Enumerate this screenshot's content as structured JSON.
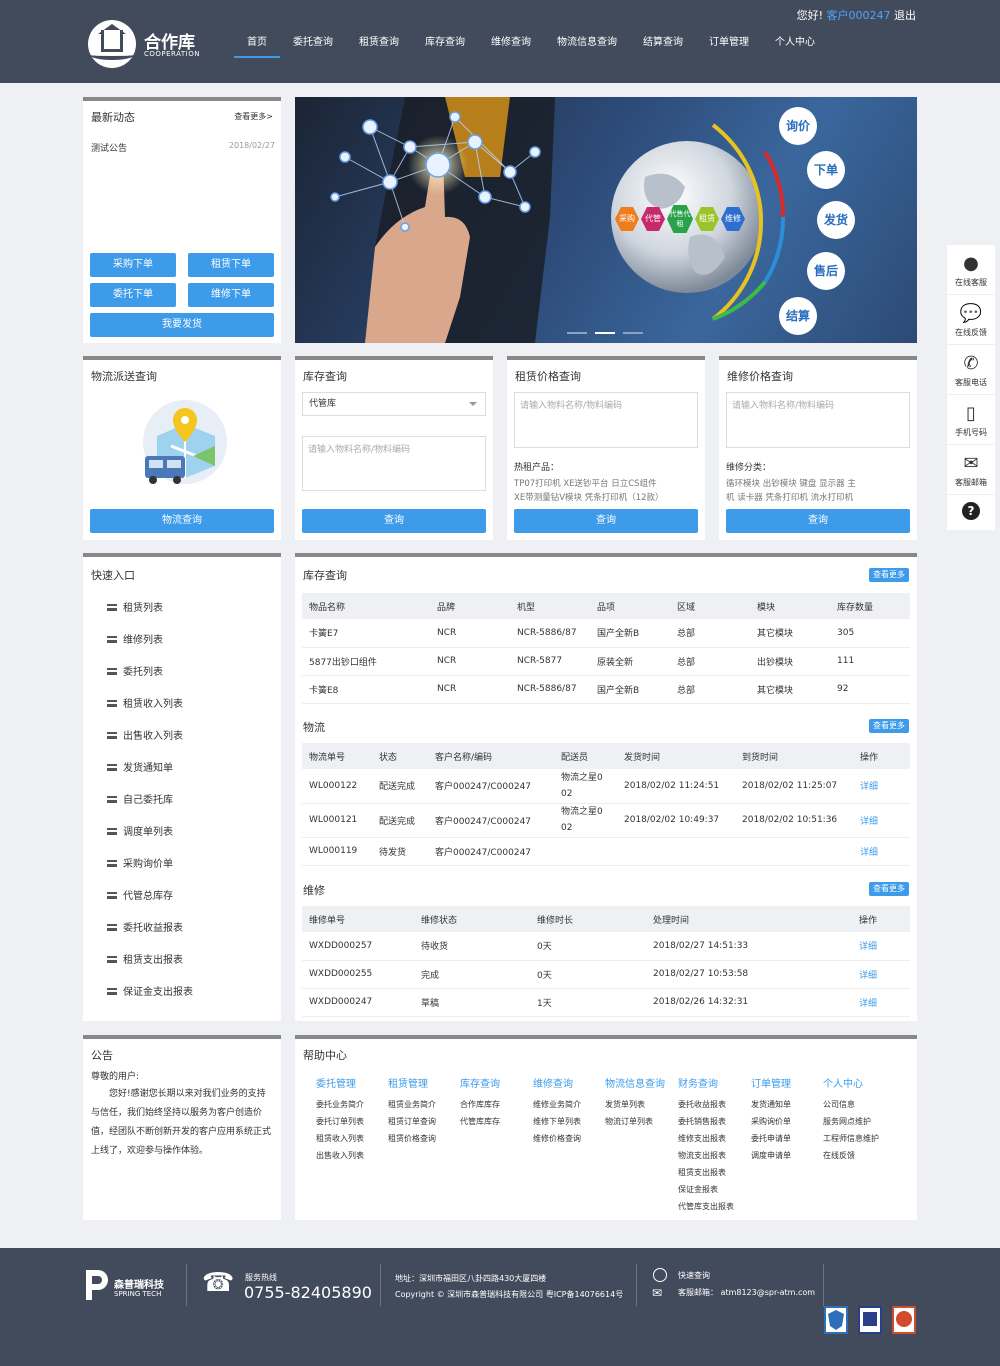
{
  "header": {
    "logo_title": "合作库",
    "logo_subtitle": "COOPERATION",
    "greeting": "您好!",
    "account": "客户000247",
    "logout": "退出",
    "nav": [
      "首页",
      "委托查询",
      "租赁查询",
      "库存查询",
      "维修查询",
      "物流信息查询",
      "结算查询",
      "订单管理",
      "个人中心"
    ]
  },
  "news": {
    "title": "最新动态",
    "more": "查看更多>",
    "items": [
      {
        "title": "测试公告",
        "date": "2018/02/27"
      }
    ],
    "buttons": [
      "采购下单",
      "租赁下单",
      "委托下单",
      "维修下单"
    ],
    "ship_button": "我要发货"
  },
  "banner": {
    "bubbles": [
      "询价",
      "下单",
      "发货",
      "售后",
      "结算"
    ],
    "hexes": [
      "采购",
      "代管",
      "代售代租",
      "租赁",
      "维修"
    ]
  },
  "logistics_query": {
    "title": "物流派送查询",
    "button": "物流查询"
  },
  "stock_query": {
    "title": "库存查询",
    "select_value": "代管库",
    "placeholder": "请输入物料名称/物料编码",
    "button": "查询"
  },
  "rent_price": {
    "title": "租赁价格查询",
    "placeholder": "请输入物料名称/物料编码",
    "hot_label": "热租产品：",
    "hot_line1": "TP07打印机   XE送钞平台   日立CS组件",
    "hot_line2": "XE带测量钻V模块   凭条打印机（12款）",
    "button": "查询"
  },
  "repair_price": {
    "title": "维修价格查询",
    "placeholder": "请输入物料名称/物料编码",
    "cat_label": "维修分类：",
    "cat_line1": "循环模块   出钞模块   键盘   显示器   主",
    "cat_line2": "机   读卡器   凭条打印机   流水打印机",
    "button": "查询"
  },
  "quick": {
    "title": "快速入口",
    "items": [
      "租赁列表",
      "维修列表",
      "委托列表",
      "租赁收入列表",
      "出售收入列表",
      "发货通知单",
      "自己委托库",
      "调度单列表",
      "采购询价单",
      "代管总库存",
      "委托收益报表",
      "租赁支出报表",
      "保证金支出报表"
    ]
  },
  "stock_table": {
    "title": "库存查询",
    "more": "查看更多",
    "headers": [
      "物品名称",
      "品牌",
      "机型",
      "品项",
      "区域",
      "模块",
      "库存数量"
    ],
    "rows": [
      [
        "卡簧E7",
        "NCR",
        "NCR-5886/87",
        "国产全新B",
        "总部",
        "其它模块",
        "305"
      ],
      [
        "5877出钞口组件",
        "NCR",
        "NCR-5877",
        "原装全新",
        "总部",
        "出钞模块",
        "111"
      ],
      [
        "卡簧E8",
        "NCR",
        "NCR-5886/87",
        "国产全新B",
        "总部",
        "其它模块",
        "92"
      ]
    ]
  },
  "logistics_table": {
    "title": "物流",
    "more": "查看更多",
    "headers": [
      "物流单号",
      "状态",
      "客户名称/编码",
      "配送员",
      "发货时间",
      "到货时间",
      "操作"
    ],
    "rows": [
      [
        "WL000122",
        "配送完成",
        "客户000247/C000247",
        "物流之星0 02",
        "2018/02/02 11:24:51",
        "2018/02/02 11:25:07",
        "详细"
      ],
      [
        "WL000121",
        "配送完成",
        "客户000247/C000247",
        "物流之星0 02",
        "2018/02/02 10:49:37",
        "2018/02/02 10:51:36",
        "详细"
      ],
      [
        "WL000119",
        "待发货",
        "客户000247/C000247",
        "",
        "",
        "",
        "详细"
      ]
    ]
  },
  "repair_table": {
    "title": "维修",
    "more": "查看更多",
    "headers": [
      "维修单号",
      "维修状态",
      "维修时长",
      "处理时间",
      "操作"
    ],
    "rows": [
      [
        "WXDD000257",
        "待收货",
        "0天",
        "2018/02/27 14:51:33",
        "详细"
      ],
      [
        "WXDD000255",
        "完成",
        "0天",
        "2018/02/27 10:53:58",
        "详细"
      ],
      [
        "WXDD000247",
        "草稿",
        "1天",
        "2018/02/26 14:32:31",
        "详细"
      ]
    ]
  },
  "notice": {
    "title": "公告",
    "salutation": "尊敬的用户:",
    "body": "您好!感谢您长期以来对我们业务的支持与信任，我们始终坚持以服务为客户创造价值，经团队不断创新开发的客户应用系统正式上线了，欢迎参与操作体验。"
  },
  "help": {
    "title": "帮助中心",
    "columns": [
      {
        "head": "委托管理",
        "links": [
          "委托业务简介",
          "委托订单列表",
          "租赁收入列表",
          "出售收入列表"
        ]
      },
      {
        "head": "租赁管理",
        "links": [
          "租赁业务简介",
          "租赁订单查询",
          "租赁价格查询"
        ]
      },
      {
        "head": "库存查询",
        "links": [
          "合作库库存",
          "代管库库存"
        ]
      },
      {
        "head": "维修查询",
        "links": [
          "维修业务简介",
          "维修下单列表",
          "维修价格查询"
        ]
      },
      {
        "head": "物流信息查询",
        "links": [
          "发货单列表",
          "物流订单列表"
        ]
      },
      {
        "head": "财务查询",
        "links": [
          "委托收益报表",
          "委托销售报表",
          "维修支出报表",
          "物流支出报表",
          "租赁支出报表",
          "保证金报表",
          "代管库支出报表"
        ]
      },
      {
        "head": "订单管理",
        "links": [
          "发货通知单",
          "采购询价单",
          "委托申请单",
          "调度申请单"
        ]
      },
      {
        "head": "个人中心",
        "links": [
          "公司信息",
          "服务网点维护",
          "工程师信息维护",
          "在线反馈"
        ]
      }
    ]
  },
  "sidebar": [
    "在线客服",
    "在线反馈",
    "客服电话",
    "手机号码",
    "客服邮箱"
  ],
  "footer": {
    "brand": "森普瑞科技",
    "brand_en": "SPRING TECH",
    "hotline_label": "服务热线",
    "hotline": "0755-82405890",
    "address": "地址：深圳市福田区八卦四路430大厦四楼",
    "copyright": "Copyright © 深圳市森普瑞科技有限公司 粤ICP备14076614号",
    "quick_label": "快速查询",
    "email": "客服邮箱：   atm8123@spr-atm.com"
  }
}
